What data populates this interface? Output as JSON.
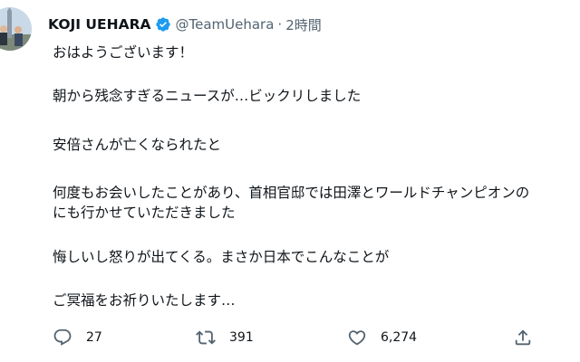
{
  "tweet": {
    "display_name": "KOJI UEHARA",
    "handle": "@TeamUehara",
    "separator": "·",
    "time": "2時間",
    "lines": [
      "おはようございます！",
      "朝から残念すぎるニュースが…ビックリしました",
      "安倍さんが亡くなられたと",
      "何度もお会いしたことがあり、首相官邸では田澤とワールドチャンピオンの",
      "にも行かせていただきました",
      "悔しいし怒りが出てくる。まさか日本でこんなことが",
      "ご冥福をお祈りいたします…"
    ]
  },
  "actions": {
    "reply_count": "27",
    "retweet_count": "391",
    "like_count": "6,274"
  },
  "icons": {
    "verified": "verified-badge-icon",
    "reply": "reply-icon",
    "retweet": "retweet-icon",
    "like": "heart-icon",
    "share": "share-icon"
  },
  "colors": {
    "verified": "#1d9bf0",
    "text": "#0f1419",
    "secondary": "#536471"
  }
}
